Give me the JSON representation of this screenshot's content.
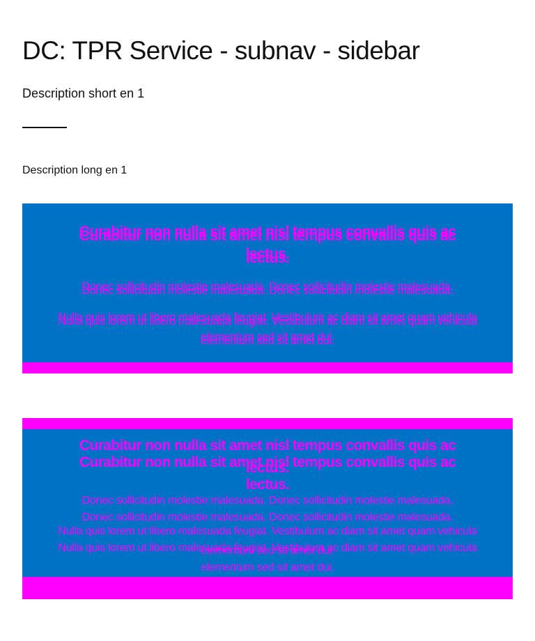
{
  "page": {
    "title": "DC: TPR Service - subnav - sidebar",
    "description_short": "Description short en 1",
    "description_long": "Description long en 1"
  },
  "sidebar": {
    "heading": "Curabitur non nulla sit amet nisl tempus convallis quis ac lectus.",
    "paragraph_1": "Donec sollicitudin molestie malesuada. Donec sollicitudin molestie malesuada.",
    "paragraph_2": "Nulla quis lorem ut libero malesuada feugiat. Vestibulum ac diam sit amet quam vehicula elementum sed sit amet dui."
  },
  "colors": {
    "blue": "#0072c6",
    "magenta": "#ff00ff"
  }
}
